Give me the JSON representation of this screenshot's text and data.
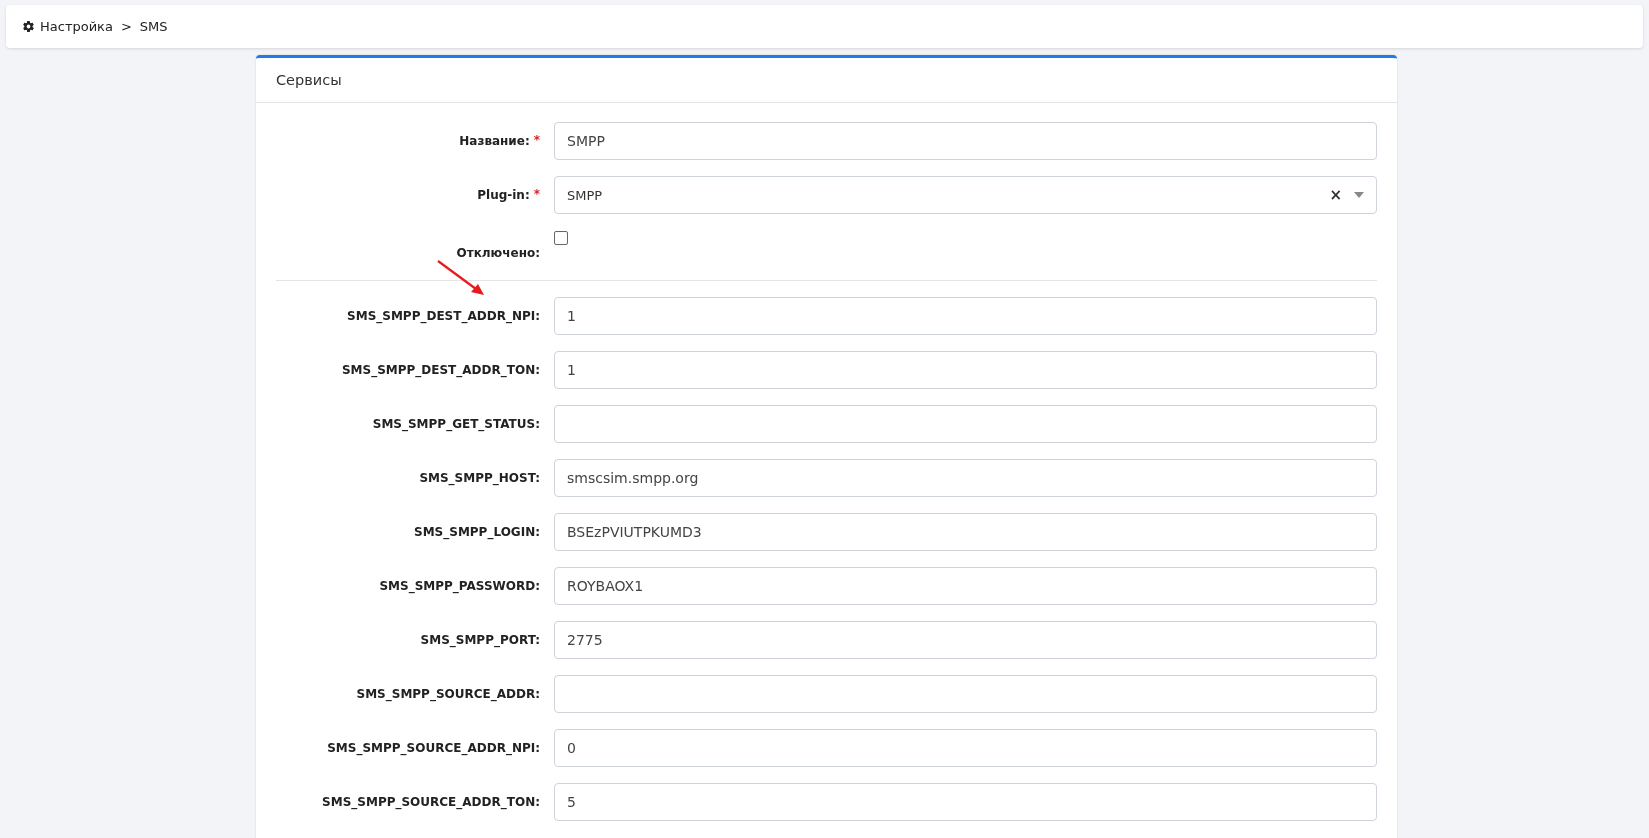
{
  "breadcrumb": {
    "items": [
      "Настройка",
      "SMS"
    ],
    "separator": ">"
  },
  "card": {
    "title": "Сервисы"
  },
  "fields": [
    {
      "kind": "text",
      "label": "Название:",
      "required_mark": "*",
      "value": "SMPP"
    },
    {
      "kind": "select",
      "label": "Plug-in:",
      "required_mark": "*",
      "value": "SMPP",
      "clear": "×"
    },
    {
      "kind": "checkbox",
      "label": "Отключено:",
      "checked": false
    },
    {
      "kind": "divider"
    },
    {
      "kind": "text",
      "label": "SMS_SMPP_DEST_ADDR_NPI:",
      "value": "1",
      "annotated": true
    },
    {
      "kind": "text",
      "label": "SMS_SMPP_DEST_ADDR_TON:",
      "value": "1"
    },
    {
      "kind": "text",
      "label": "SMS_SMPP_GET_STATUS:"
    },
    {
      "kind": "text",
      "label": "SMS_SMPP_HOST:",
      "value": "smscsim.smpp.org"
    },
    {
      "kind": "text",
      "label": "SMS_SMPP_LOGIN:",
      "value": "BSEzPVIUTPKUMD3"
    },
    {
      "kind": "text",
      "label": "SMS_SMPP_PASSWORD:",
      "value": "ROYBAOX1"
    },
    {
      "kind": "text",
      "label": "SMS_SMPP_PORT:",
      "value": "2775"
    },
    {
      "kind": "text",
      "label": "SMS_SMPP_SOURCE_ADDR:"
    },
    {
      "kind": "text",
      "label": "SMS_SMPP_SOURCE_ADDR_NPI:",
      "value": "0"
    },
    {
      "kind": "text",
      "label": "SMS_SMPP_SOURCE_ADDR_TON:",
      "value": "5"
    }
  ]
}
